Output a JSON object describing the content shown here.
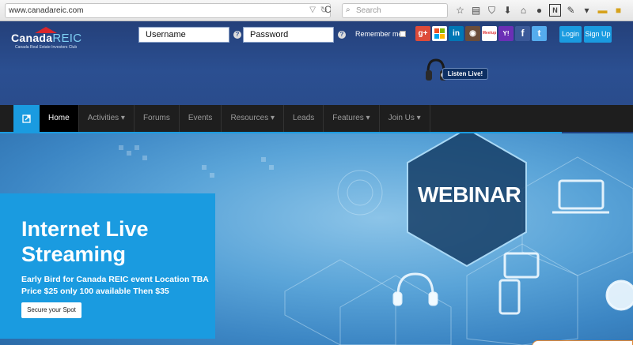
{
  "browser": {
    "url": "www.canadareic.com",
    "search_placeholder": "Search",
    "toolbar_icons": [
      "star-icon",
      "reading-list-icon",
      "pocket-icon",
      "download-icon",
      "home-icon",
      "chat-icon",
      "extension-n-icon",
      "wrench-icon",
      "menu-icon",
      "folder-icon",
      "badge-icon"
    ]
  },
  "header": {
    "logo_main": "Canada",
    "logo_accent": "REIC",
    "logo_tagline": "Canada Real Estate Investors Club",
    "username_placeholder": "Username",
    "password_placeholder": "Password",
    "help_glyph": "?",
    "remember_label": "Remember me",
    "social": [
      {
        "name": "google-plus",
        "glyph": "g+",
        "color": "#dd4b39"
      },
      {
        "name": "microsoft",
        "glyph": "",
        "color": "#ffffff"
      },
      {
        "name": "linkedin",
        "glyph": "in",
        "color": "#0077b5"
      },
      {
        "name": "instagram",
        "glyph": "◉",
        "color": "#6b4d3a"
      },
      {
        "name": "meetup",
        "glyph": "Meetup",
        "color": "#ffffff"
      },
      {
        "name": "yahoo",
        "glyph": "Y!",
        "color": "#6b2fb5"
      },
      {
        "name": "facebook",
        "glyph": "f",
        "color": "#3b5998"
      },
      {
        "name": "twitter",
        "glyph": "t",
        "color": "#55acee"
      }
    ],
    "login_label": "Login",
    "signup_label": "Sign Up",
    "listen_label": "Listen Live!"
  },
  "nav": {
    "items": [
      {
        "label": "Home",
        "active": true
      },
      {
        "label": "Activities ▾",
        "active": false
      },
      {
        "label": "Forums",
        "active": false
      },
      {
        "label": "Events",
        "active": false
      },
      {
        "label": "Resources ▾",
        "active": false
      },
      {
        "label": "Leads",
        "active": false
      },
      {
        "label": "Features ▾",
        "active": false
      },
      {
        "label": "Join Us ▾",
        "active": false
      }
    ]
  },
  "hero": {
    "webinar_text": "WEBINAR",
    "title": "Internet Live Streaming",
    "description": "Early Bird for Canada REIC event Location TBA Price $25 only 100 available Then $35",
    "cta_label": "Secure your Spot"
  },
  "colors": {
    "brand_blue": "#1a9be0",
    "header_navy": "#2b4f91",
    "nav_dark": "#1e1e1e"
  }
}
